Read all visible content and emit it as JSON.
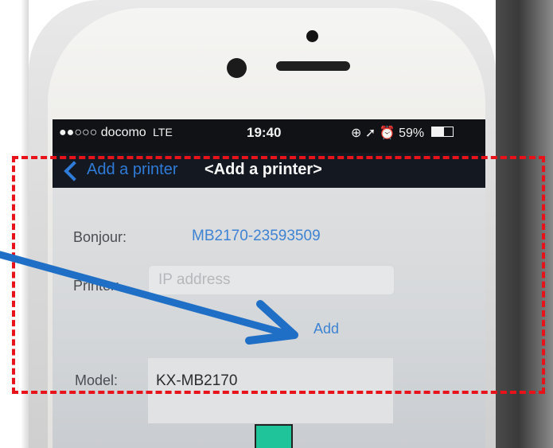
{
  "status_bar": {
    "signal": "●●○○○",
    "carrier": "docomo",
    "network": "LTE",
    "time": "19:40",
    "indicators": "⊕ ➚ ⏰",
    "battery": "59%",
    "battery_level": 0.59
  },
  "nav": {
    "back_label": "Add a printer",
    "title": "<Add a printer>"
  },
  "form": {
    "bonjour_label": "Bonjour:",
    "bonjour_value": "MB2170-23593509",
    "printer_label": "Printer:",
    "ip_placeholder": "IP address",
    "add_label": "Add",
    "model_label": "Model:",
    "model_value": "KX-MB2170"
  },
  "colors": {
    "link_blue": "#3e83d3",
    "highlight_red": "#e8131a",
    "arrow_blue": "#1f6fc6",
    "button_green": "#1fc49a"
  }
}
